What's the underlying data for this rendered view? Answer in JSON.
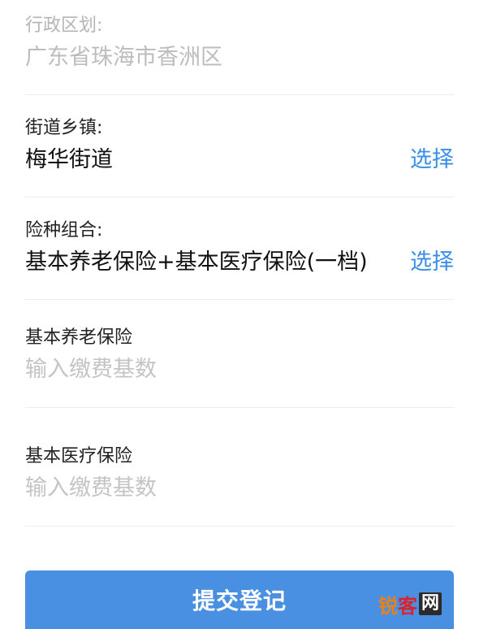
{
  "region": {
    "label": "行政区划:",
    "value": "广东省珠海市香洲区"
  },
  "street": {
    "label": "街道乡镇:",
    "value": "梅华街道",
    "select_label": "选择"
  },
  "insurance_combo": {
    "label": "险种组合:",
    "value": "基本养老保险+基本医疗保险(一档)",
    "select_label": "选择"
  },
  "pension": {
    "label": "基本养老保险",
    "placeholder": "输入缴费基数"
  },
  "medical": {
    "label": "基本医疗保险",
    "placeholder": "输入缴费基数"
  },
  "submit": {
    "label": "提交登记"
  },
  "watermark": {
    "part1": "锐",
    "part2": "客",
    "part3": "网"
  },
  "colors": {
    "accent": "#3a8ee6",
    "button": "#4a90e2"
  }
}
